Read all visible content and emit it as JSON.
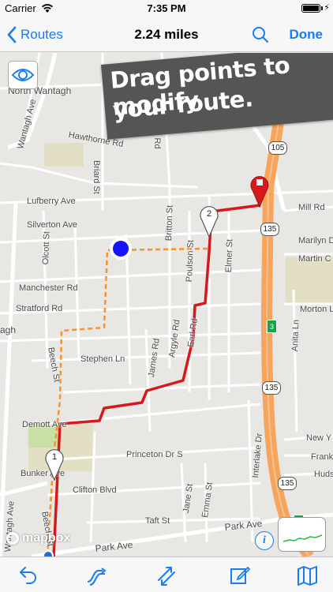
{
  "status_bar": {
    "carrier": "Carrier",
    "time": "7:35 PM"
  },
  "nav": {
    "back_label": "Routes",
    "title": "2.24 miles",
    "done_label": "Done"
  },
  "colors": {
    "accent": "#1a7cf5",
    "route_red": "#d7191c",
    "route_orange": "#f5922a",
    "highway": "#f6a55e",
    "current_location": "#1414ff"
  },
  "banner": {
    "line1": "Drag points to modify",
    "line2": "your route."
  },
  "map": {
    "attribution": "mapbox",
    "info_label": "i",
    "street_labels": [
      "North Wantagh",
      "Wantagh Ave",
      "Hawthorne Rd",
      "Briard St",
      "Campbell Rd",
      "Lufberry Ave",
      "Silverton Ave",
      "Olcott St",
      "Britton St",
      "Poulson St",
      "Elmer St",
      "Manchester Rd",
      "Stratford Rd",
      "agh",
      "Beech St",
      "Stephen Ln",
      "James Rd",
      "Argyle Rd",
      "Earl Rd",
      "Demott Ave",
      "Princeton Dr S",
      "Bunker Ave",
      "Clifton Blvd",
      "Taft St",
      "Jane St",
      "Emma St",
      "Interlake Dr",
      "Park Ave",
      "Park Ave",
      "Mill Rd",
      "Marilyn D",
      "Martin C",
      "Morton L",
      "Anita Ln",
      "New Y",
      "Frank",
      "Huds",
      "Wantagh Ave",
      "Beech St"
    ],
    "shields": [
      "105",
      "135",
      "135",
      "135",
      "135"
    ],
    "exit_shields": [
      "3",
      "3"
    ],
    "waypoints": [
      "2",
      "1"
    ]
  },
  "toolbar": {
    "items": [
      "undo-icon",
      "route-tools-icon",
      "reverse-route-icon",
      "edit-icon",
      "map-icon"
    ]
  }
}
